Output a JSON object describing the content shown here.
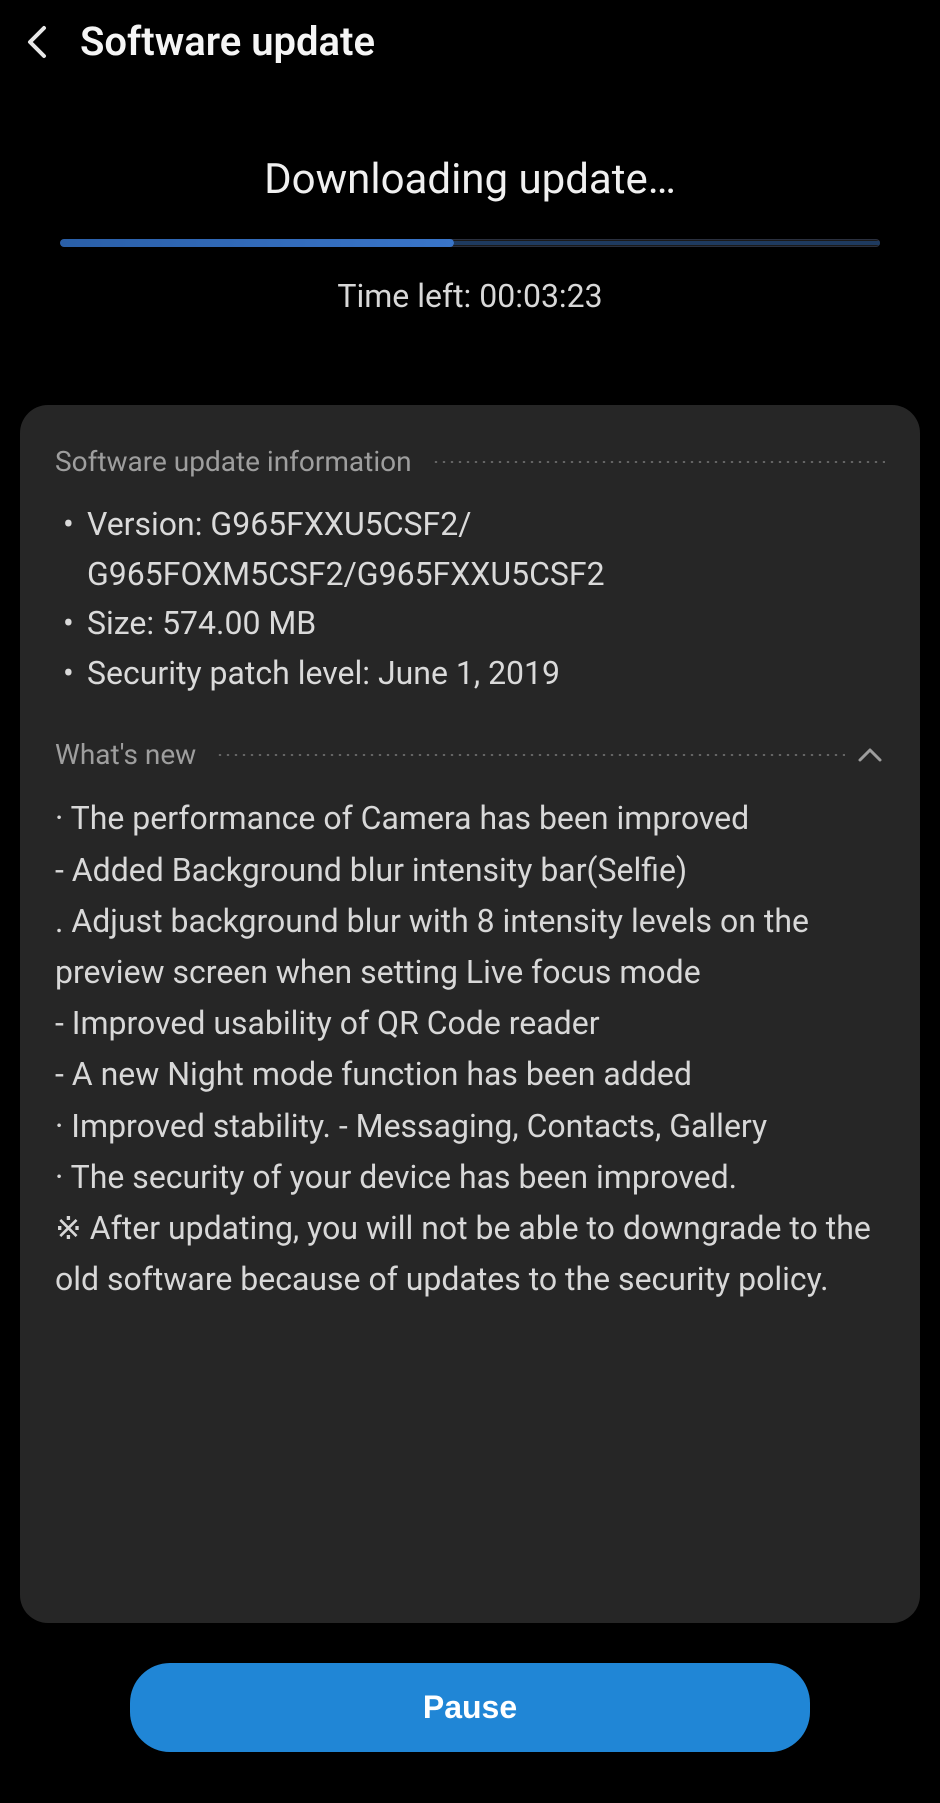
{
  "header": {
    "title": "Software update"
  },
  "download": {
    "title": "Downloading update…",
    "time_left_label": "Time left: 00:03:23",
    "progress_percent": 48
  },
  "info": {
    "section_title": "Software update information",
    "version_label": "Version: G965FXXU5CSF2/ G965FOXM5CSF2/G965FXXU5CSF2",
    "size_label": "Size: 574.00 MB",
    "security_label": "Security patch level: June 1, 2019"
  },
  "whats_new": {
    "section_title": "What's new",
    "line1": "· The performance of Camera has been improved",
    "line2": " - Added Background blur intensity bar(Selfie)",
    "line3": "  . Adjust background blur with 8 intensity levels on the preview screen when setting Live focus mode",
    "line4": " - Improved usability of QR Code reader",
    "line5": " - A new Night mode function has been added",
    "line6": "· Improved stability. - Messaging, Contacts, Gallery",
    "line7": "· The security of your device has been improved.",
    "line8": "※ After updating, you will not be able to downgrade to the old software because of updates to the security policy."
  },
  "buttons": {
    "pause_label": "Pause"
  }
}
